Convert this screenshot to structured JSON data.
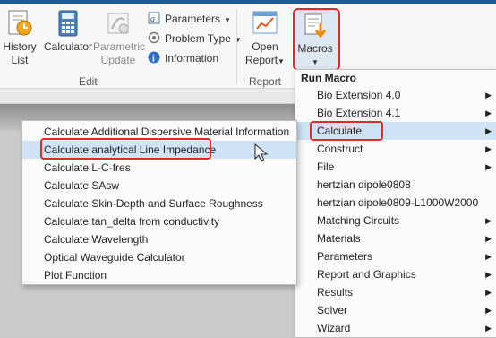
{
  "ribbon": {
    "history_list": {
      "line1": "History",
      "line2": "List"
    },
    "calculator": "Calculator",
    "parametric_update": {
      "line1": "Parametric",
      "line2": "Update"
    },
    "parameters": "Parameters",
    "problem_type": "Problem Type",
    "information": "Information",
    "open_report": {
      "line1": "Open",
      "line2": "Report"
    },
    "macros": "Macros",
    "groups": {
      "edit": "Edit",
      "report": "Report"
    }
  },
  "run_macro_menu": {
    "header": "Run Macro",
    "items": [
      {
        "label": "Bio Extension 4.0",
        "submenu": true
      },
      {
        "label": "Bio Extension 4.1",
        "submenu": true
      },
      {
        "label": "Calculate",
        "submenu": true,
        "selected": true
      },
      {
        "label": "Construct",
        "submenu": true
      },
      {
        "label": "File",
        "submenu": true
      },
      {
        "label": "hertzian dipole0808",
        "submenu": false
      },
      {
        "label": "hertzian dipole0809-L1000W2000",
        "submenu": false
      },
      {
        "label": "Matching Circuits",
        "submenu": true
      },
      {
        "label": "Materials",
        "submenu": true
      },
      {
        "label": "Parameters",
        "submenu": true
      },
      {
        "label": "Report and Graphics",
        "submenu": true
      },
      {
        "label": "Results",
        "submenu": true
      },
      {
        "label": "Solver",
        "submenu": true
      },
      {
        "label": "Wizard",
        "submenu": true
      }
    ]
  },
  "calculate_submenu": {
    "items": [
      {
        "label": "Calculate Additional Dispersive Material Information"
      },
      {
        "label": "Calculate analytical Line Impedance",
        "selected": true
      },
      {
        "label": "Calculate L-C-fres"
      },
      {
        "label": "Calculate SAsw"
      },
      {
        "label": "Calculate Skin-Depth and Surface Roughness"
      },
      {
        "label": "Calculate tan_delta from conductivity"
      },
      {
        "label": "Calculate Wavelength"
      },
      {
        "label": "Optical Waveguide Calculator"
      },
      {
        "label": "Plot Function"
      }
    ]
  },
  "colors": {
    "highlight": "#e02a2a",
    "selection": "#cfe3f7",
    "title_bar": "#1f5d99"
  }
}
